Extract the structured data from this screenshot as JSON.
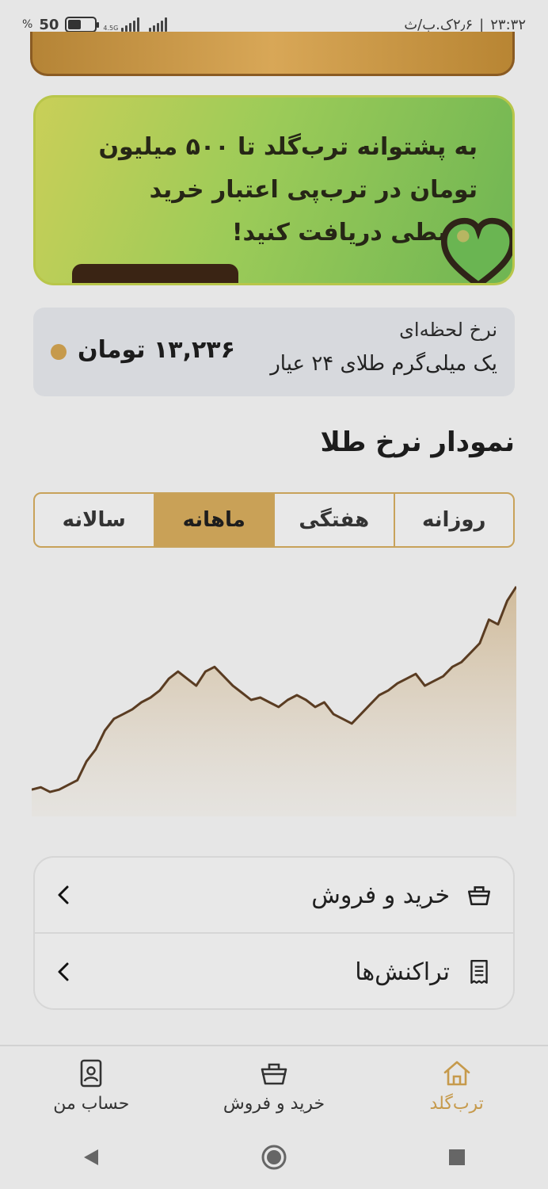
{
  "status_bar": {
    "time": "۲۳:۳۲",
    "data_speed": "۲٫۶ک.ب/ث",
    "battery": "50",
    "battery_unit": "%",
    "network": "4.5G"
  },
  "promo": {
    "text": "به پشتوانه ترب‌گلد تا ۵۰۰ میلیون تومان در ترب‌پی اعتبار خرید قسطی دریافت کنید!"
  },
  "rate_card": {
    "title": "نرخ لحظه‌ای",
    "subtitle": "یک میلی‌گرم طلای ۲۴ عیار",
    "value": "۱۳,۲۳۶ تومان"
  },
  "chart_section": {
    "title": "نمودار نرخ طلا",
    "tabs": [
      {
        "label": "روزانه",
        "active": false
      },
      {
        "label": "هفتگی",
        "active": false
      },
      {
        "label": "ماهانه",
        "active": true
      },
      {
        "label": "سالانه",
        "active": false
      }
    ]
  },
  "chart_data": {
    "type": "area",
    "title": "",
    "xlabel": "",
    "ylabel": "",
    "values": [
      8,
      9,
      7,
      8,
      10,
      12,
      20,
      25,
      33,
      38,
      40,
      42,
      45,
      47,
      50,
      55,
      58,
      55,
      52,
      58,
      60,
      56,
      52,
      49,
      46,
      47,
      45,
      43,
      46,
      48,
      46,
      43,
      45,
      40,
      38,
      36,
      40,
      44,
      48,
      50,
      53,
      55,
      57,
      52,
      54,
      56,
      60,
      62,
      66,
      70,
      80,
      78,
      88,
      94
    ]
  },
  "menu": {
    "items": [
      {
        "label": "خرید و فروش",
        "icon": "basket-icon"
      },
      {
        "label": "تراکنش‌ها",
        "icon": "receipt-icon"
      }
    ]
  },
  "bottom_nav": {
    "items": [
      {
        "label": "ترب‌گلد",
        "icon": "home-icon",
        "active": true
      },
      {
        "label": "خرید و فروش",
        "icon": "basket-icon",
        "active": false
      },
      {
        "label": "حساب من",
        "icon": "account-icon",
        "active": false
      }
    ]
  },
  "colors": {
    "accent": "#c69a4c",
    "chart_line": "#5a3c22",
    "promo_green": "#8fc558"
  }
}
